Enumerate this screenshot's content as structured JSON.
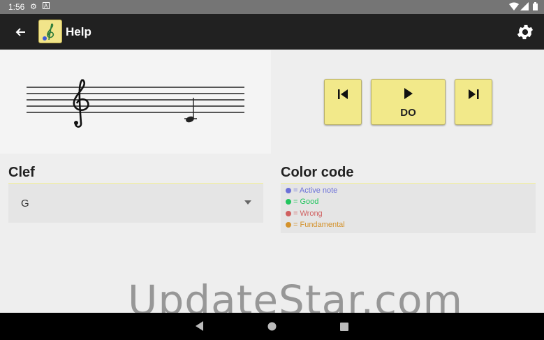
{
  "status_bar": {
    "time": "1:56",
    "icons": [
      "gear-icon",
      "a-badge-icon",
      "wifi-icon",
      "signal-icon",
      "battery-icon"
    ]
  },
  "app_bar": {
    "title": "Help",
    "back_icon": "arrow-back-icon",
    "settings_icon": "gear-icon"
  },
  "player": {
    "prev_icon": "skip-previous-icon",
    "play_icon": "play-icon",
    "play_label": "DO",
    "next_icon": "skip-next-icon",
    "button_color": "#f2e98a"
  },
  "clef": {
    "title": "Clef",
    "selected": "G"
  },
  "color_code": {
    "title": "Color code",
    "items": [
      {
        "label": "= Active note",
        "color": "#6b70d8"
      },
      {
        "label": "= Good",
        "color": "#22c55e"
      },
      {
        "label": "= Wrong",
        "color": "#d06060"
      },
      {
        "label": "= Fundamental",
        "color": "#d4922b"
      }
    ]
  },
  "watermark": "UpdateStar.com",
  "nav_bar": {
    "icons": [
      "back-triangle-icon",
      "home-circle-icon",
      "recents-square-icon"
    ]
  }
}
